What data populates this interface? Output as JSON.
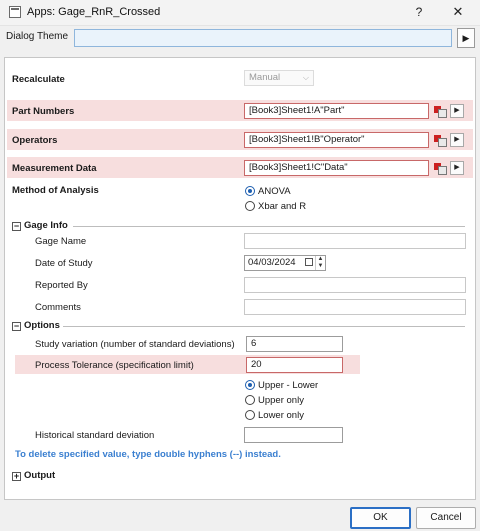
{
  "window": {
    "title": "Apps: Gage_RnR_Crossed",
    "help_label": "?",
    "close_label": "✕"
  },
  "dialog_theme": {
    "label": "Dialog Theme",
    "value": "",
    "button_label": "▶"
  },
  "recalculate": {
    "label": "Recalculate",
    "value": "Manual"
  },
  "inputs": {
    "part_numbers": {
      "label": "Part Numbers",
      "value": "[Book3]Sheet1!A\"Part\""
    },
    "operators": {
      "label": "Operators",
      "value": "[Book3]Sheet1!B\"Operator\""
    },
    "measurement_data": {
      "label": "Measurement Data",
      "value": "[Book3]Sheet1!C\"Data\""
    },
    "arrow_label": "▶"
  },
  "method": {
    "label": "Method of Analysis",
    "options": [
      "ANOVA",
      "Xbar and R"
    ],
    "selected": "ANOVA"
  },
  "gage_info": {
    "title": "Gage Info",
    "gage_name_label": "Gage Name",
    "gage_name_value": "",
    "date_label": "Date of Study",
    "date_value": "04/03/2024",
    "reported_by_label": "Reported By",
    "reported_by_value": "",
    "comments_label": "Comments",
    "comments_value": ""
  },
  "options": {
    "title": "Options",
    "study_variation_label": "Study variation (number of standard deviations)",
    "study_variation_value": "6",
    "process_tolerance_label": "Process Tolerance (specification limit)",
    "process_tolerance_value": "20",
    "tolerance_options": [
      "Upper - Lower",
      "Upper only",
      "Lower only"
    ],
    "tolerance_selected": "Upper - Lower",
    "historical_sd_label": "Historical standard deviation",
    "historical_sd_value": ""
  },
  "note": "To delete specified value, type double hyphens (--) instead.",
  "output": {
    "title": "Output"
  },
  "footer": {
    "ok_label": "OK",
    "cancel_label": "Cancel"
  },
  "colors": {
    "error_band": "#f7dede",
    "accent": "#2b6fc5",
    "note_text": "#3a7fd0"
  }
}
